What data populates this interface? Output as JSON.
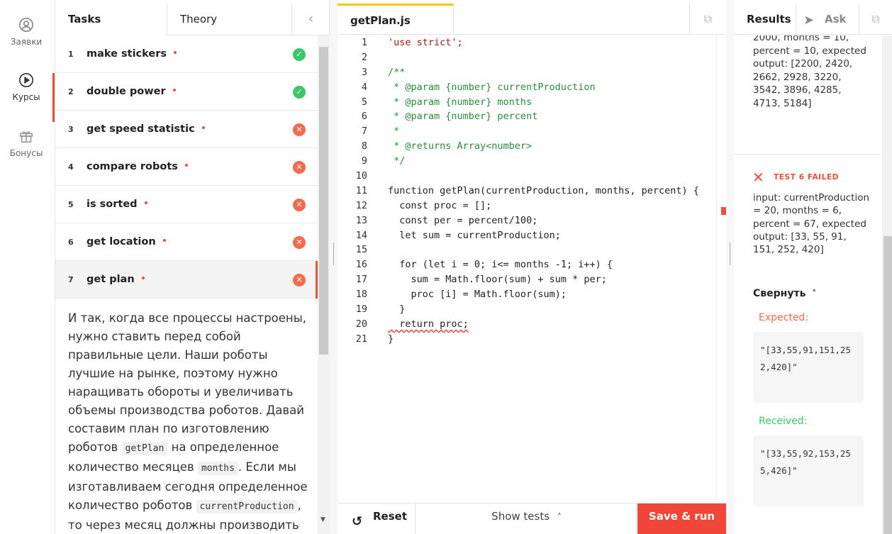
{
  "nav": {
    "items": [
      {
        "label": "Заявки",
        "icon": "user-circle-icon"
      },
      {
        "label": "Курсы",
        "icon": "play-circle-icon"
      },
      {
        "label": "Бонусы",
        "icon": "gift-icon"
      }
    ]
  },
  "tasks_panel": {
    "tabs": [
      "Tasks",
      "Theory"
    ],
    "collapse_icon": "chevron-left-icon",
    "tasks": [
      {
        "num": "1",
        "name": "make stickers",
        "status": "pass"
      },
      {
        "num": "2",
        "name": "double power",
        "status": "pass"
      },
      {
        "num": "3",
        "name": "get speed statistic",
        "status": "fail"
      },
      {
        "num": "4",
        "name": "compare robots",
        "status": "fail"
      },
      {
        "num": "5",
        "name": "is sorted",
        "status": "fail"
      },
      {
        "num": "6",
        "name": "get location",
        "status": "fail"
      },
      {
        "num": "7",
        "name": "get plan",
        "status": "fail"
      }
    ],
    "description": {
      "p1": "И так, когда все процессы настроены, нужно ставить перед собой правильные цели. Наши роботы лучшие на рынке, поэтому нужно наращивать обороты и увеличивать объемы производства роботов. Давай составим план по изготовлению роботов",
      "code1": "getPlan",
      "p2": "на определенное количество месяцев",
      "code2": "months",
      "p3": ". Если мы изготавливаем сегодня определенное количество роботов",
      "code3": "currentProduction",
      "p4": ", то через месяц должны производить на определенное"
    }
  },
  "editor": {
    "file_tab": "getPlan.js",
    "lines": [
      "'use strict';",
      "",
      "/**",
      " * @param {number} currentProduction",
      " * @param {number} months",
      " * @param {number} percent",
      " *",
      " * @returns Array<number>",
      " */",
      "",
      "function getPlan(currentProduction, months, percent) {",
      "  const proc = [];",
      "  const per = percent/100;",
      "  let sum = currentProduction;",
      "",
      "  for (let i = 0; i<= months -1; i++) {",
      "    sum = Math.floor(sum) + sum * per;",
      "    proc [i] = Math.floor(sum);",
      "  }",
      "  return proc;",
      "}"
    ],
    "footer": {
      "reset": "Reset",
      "show_tests": "Show tests",
      "save_run": "Save & run"
    }
  },
  "results": {
    "tabs": {
      "results": "Results",
      "ask": "Ask"
    },
    "previous_test_text": "2000, months = 10, percent = 10, expected output: [2200, 2420, 2662, 2928, 3220, 3542, 3896, 4285, 4713, 5184]",
    "failed_label": "TEST 6 FAILED",
    "failed_input": "input: currentProduction = 20, months = 6, percent = 67, expected output: [33, 55, 91, 151, 252, 420]",
    "collapse_label": "Свернуть",
    "expected_label": "Expected:",
    "expected_value": "\"[33,55,91,151,252,420]\"",
    "received_label": "Received:",
    "received_value": "\"[33,55,92,153,255,426]\""
  },
  "colors": {
    "accent": "#f0463a",
    "pass": "#3cc76a",
    "fail": "#f36b4c",
    "active_tab": "#f5c518"
  }
}
